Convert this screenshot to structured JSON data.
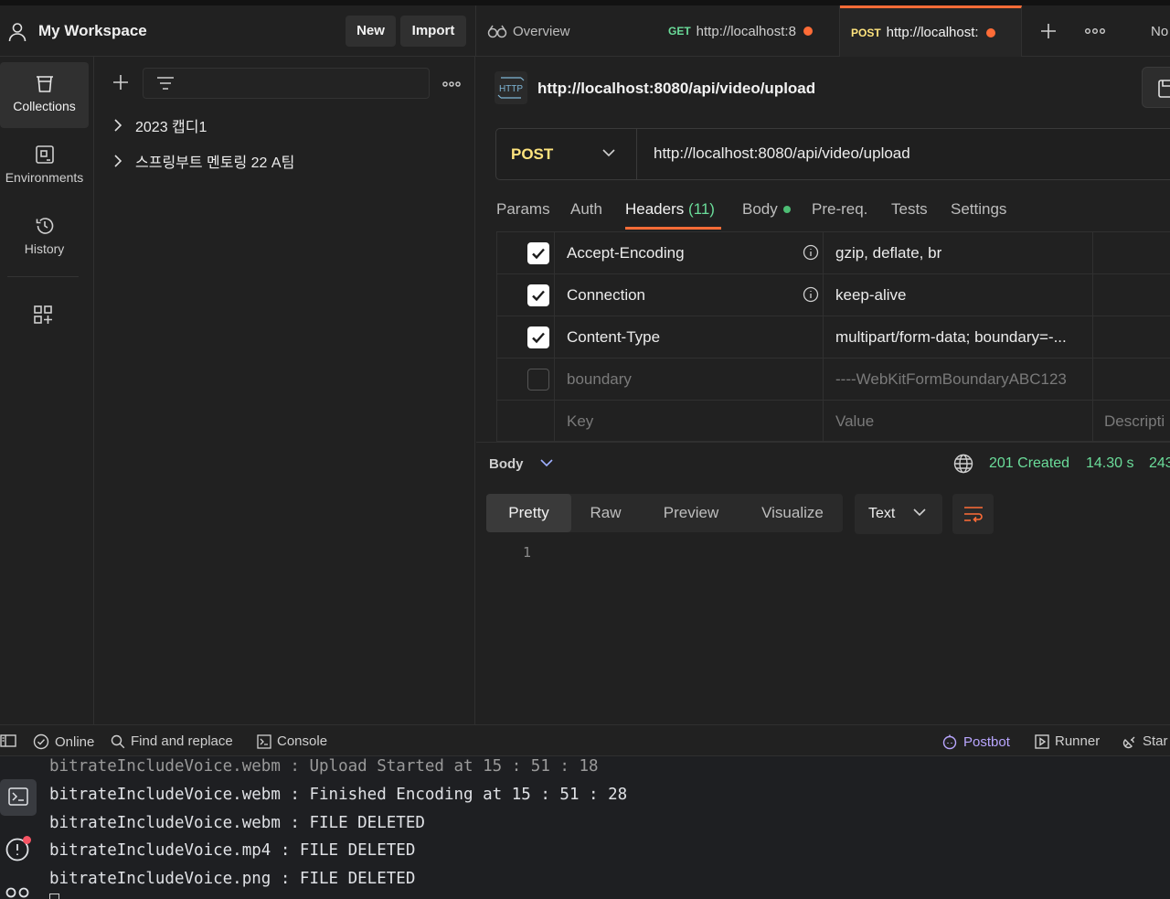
{
  "workspace": {
    "title": "My Workspace",
    "new_label": "New",
    "import_label": "Import"
  },
  "tabs": {
    "overview_label": "Overview",
    "get_method": "GET",
    "get_url": "http://localhost:8",
    "post_method": "POST",
    "post_url": "http://localhost:",
    "env_label": "No"
  },
  "sidebar": {
    "items": [
      {
        "label": "Collections",
        "icon": "trash-can-icon"
      },
      {
        "label": "Environments",
        "icon": "environment-icon"
      },
      {
        "label": "History",
        "icon": "history-icon"
      }
    ]
  },
  "collections": {
    "items": [
      {
        "label": "2023 캡디1"
      },
      {
        "label": "스프링부트 멘토링 22 A팀"
      }
    ]
  },
  "request": {
    "name": "http://localhost:8080/api/video/upload",
    "method": "POST",
    "url": "http://localhost:8080/api/video/upload",
    "http_badge": "HTTP",
    "tabs": {
      "params": "Params",
      "auth": "Auth",
      "headers": "Headers",
      "headers_count": "(11)",
      "body": "Body",
      "prereq": "Pre-req.",
      "tests": "Tests",
      "settings": "Settings"
    },
    "headers": [
      {
        "key": "Accept-Encoding",
        "value": "gzip, deflate, br",
        "checked": true,
        "info": true
      },
      {
        "key": "Connection",
        "value": "keep-alive",
        "checked": true,
        "info": true
      },
      {
        "key": "Content-Type",
        "value": "multipart/form-data; boundary=-...",
        "checked": true,
        "info": false
      },
      {
        "key": "boundary",
        "value": "----WebKitFormBoundaryABC123",
        "checked": false,
        "info": false
      }
    ],
    "header_placeholders": {
      "key": "Key",
      "value": "Value",
      "description": "Descripti"
    }
  },
  "response": {
    "body_label": "Body",
    "status": "201 Created",
    "time": "14.30 s",
    "size": "243",
    "formats": [
      "Pretty",
      "Raw",
      "Preview",
      "Visualize"
    ],
    "active_format": "Pretty",
    "language": "Text",
    "line_number": "1"
  },
  "statusbar": {
    "online": "Online",
    "find": "Find and replace",
    "console": "Console",
    "postbot": "Postbot",
    "runner": "Runner",
    "start": "Star"
  },
  "terminal": {
    "lines": [
      "bitrateIncludeVoice.webm : Upload Started at 15 : 51 : 18",
      "bitrateIncludeVoice.webm : Finished Encoding at 15 : 51 : 28",
      "bitrateIncludeVoice.webm : FILE DELETED",
      "bitrateIncludeVoice.mp4 : FILE DELETED",
      "bitrateIncludeVoice.png : FILE DELETED"
    ]
  },
  "colors": {
    "accent": "#ff6c37",
    "post": "#ffe47e",
    "get": "#6bdd9a",
    "success": "#6bdd9a",
    "postbot": "#b9a6ff"
  }
}
